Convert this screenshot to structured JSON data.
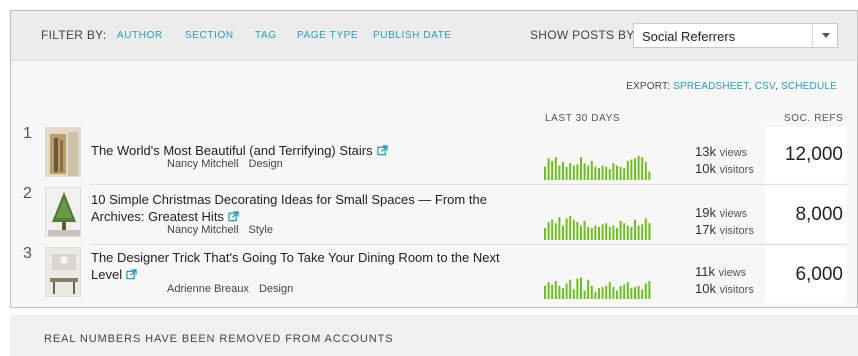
{
  "filterbar": {
    "filter_label": "FILTER BY:",
    "filters": [
      "AUTHOR",
      "SECTION",
      "TAG",
      "PAGE TYPE",
      "PUBLISH DATE"
    ],
    "show_label": "SHOW POSTS BY:",
    "show_selected": "Social Referrers"
  },
  "export": {
    "label": "EXPORT:",
    "spreadsheet": "SPREADSHEET",
    "csv": "CSV",
    "schedule": "SCHEDULE"
  },
  "columns": {
    "trend": "LAST 30 DAYS",
    "soc_refs": "SOC. REFS"
  },
  "posts": [
    {
      "rank": "1",
      "title": "The World's Most Beautiful (and Terrifying) Stairs",
      "author": "Nancy Mitchell",
      "section": "Design",
      "views": "13k",
      "views_label": "views",
      "visitors": "10k",
      "visitors_label": "visitors",
      "soc_refs": "12,000",
      "trend": [
        0.55,
        0.9,
        0.8,
        0.95,
        0.6,
        0.75,
        0.55,
        0.7,
        0.6,
        0.65,
        0.95,
        0.7,
        0.6,
        0.8,
        0.55,
        0.5,
        0.6,
        0.55,
        0.45,
        0.7,
        0.6,
        0.55,
        0.5,
        0.8,
        0.85,
        0.9,
        1.0,
        0.95,
        0.75,
        0.35
      ]
    },
    {
      "rank": "2",
      "title": "10 Simple Christmas Decorating Ideas for Small Spaces — From the Archives: Greatest Hits",
      "author": "Nancy Mitchell",
      "section": "Style",
      "views": "19k",
      "views_label": "views",
      "visitors": "17k",
      "visitors_label": "visitors",
      "soc_refs": "8,000",
      "trend": [
        0.5,
        0.75,
        0.85,
        0.7,
        0.95,
        0.6,
        0.9,
        1.0,
        0.85,
        0.75,
        0.6,
        0.8,
        0.55,
        0.5,
        0.6,
        0.55,
        0.65,
        0.7,
        0.55,
        0.6,
        0.5,
        0.8,
        0.7,
        0.6,
        0.55,
        0.85,
        0.6,
        0.65,
        0.9,
        0.7
      ]
    },
    {
      "rank": "3",
      "title": "The Designer Trick That's Going To Take Your Dining Room to the Next Level",
      "author": "Adrienne Breaux",
      "section": "Design",
      "views": "11k",
      "views_label": "views",
      "visitors": "10k",
      "visitors_label": "visitors",
      "soc_refs": "6,000",
      "trend": [
        0.55,
        0.7,
        0.6,
        0.75,
        0.55,
        0.45,
        0.65,
        0.8,
        0.4,
        0.85,
        0.9,
        0.35,
        0.8,
        0.55,
        0.3,
        0.45,
        0.5,
        0.55,
        0.7,
        0.5,
        0.35,
        0.55,
        0.6,
        0.7,
        0.45,
        0.5,
        0.55,
        0.4,
        0.65,
        0.75
      ]
    }
  ],
  "footer": {
    "note": "REAL NUMBERS HAVE BEEN REMOVED FROM ACCOUNTS"
  },
  "colors": {
    "accent": "#2a9bb7",
    "spark": "#6cbf1f"
  }
}
